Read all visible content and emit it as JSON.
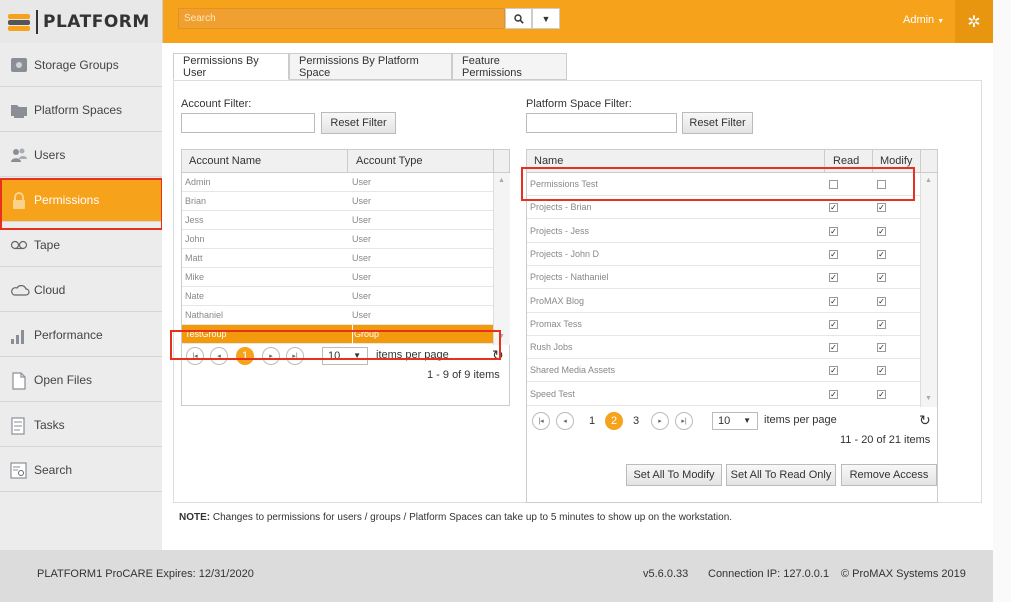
{
  "app": {
    "logo_text": "PLATFORM"
  },
  "topbar": {
    "search_placeholder": "Search",
    "search_button_icon": "search-icon",
    "dropdown_icon": "caret-down-icon",
    "user_menu": "Admin",
    "settings_icon": "gear-icon",
    "accent_color": "#f7a21b"
  },
  "sidebar": {
    "items": [
      {
        "label": "Storage Groups",
        "icon": "storage-icon"
      },
      {
        "label": "Platform Spaces",
        "icon": "folder-icon"
      },
      {
        "label": "Users",
        "icon": "users-icon"
      },
      {
        "label": "Permissions",
        "icon": "lock-icon",
        "active": true
      },
      {
        "label": "Tape",
        "icon": "tape-icon"
      },
      {
        "label": "Cloud",
        "icon": "cloud-icon"
      },
      {
        "label": "Performance",
        "icon": "bar-chart-icon"
      },
      {
        "label": "Open Files",
        "icon": "file-icon"
      },
      {
        "label": "Tasks",
        "icon": "tasks-icon"
      },
      {
        "label": "Search",
        "icon": "search-list-icon"
      }
    ]
  },
  "tabs": [
    {
      "label": "Permissions By User",
      "active": true
    },
    {
      "label": "Permissions By Platform Space"
    },
    {
      "label": "Feature Permissions"
    }
  ],
  "accounts": {
    "filter_label": "Account Filter:",
    "filter_value": "",
    "reset_label": "Reset Filter",
    "columns": [
      "Account Name",
      "Account Type"
    ],
    "rows": [
      {
        "name": "Admin",
        "type": "User"
      },
      {
        "name": "Brian",
        "type": "User"
      },
      {
        "name": "Jess",
        "type": "User"
      },
      {
        "name": "John",
        "type": "User"
      },
      {
        "name": "Matt",
        "type": "User"
      },
      {
        "name": "Mike",
        "type": "User"
      },
      {
        "name": "Nate",
        "type": "User"
      },
      {
        "name": "Nathaniel",
        "type": "User"
      },
      {
        "name": "TestGroup",
        "type": "Group",
        "selected": true
      }
    ],
    "pager": {
      "page": "1",
      "per_page": "10",
      "per_page_label": "items per page",
      "count": "1 - 9 of 9 items"
    }
  },
  "spaces": {
    "filter_label": "Platform Space Filter:",
    "filter_value": "",
    "reset_label": "Reset Filter",
    "columns": [
      "Name",
      "Read",
      "Modify"
    ],
    "rows": [
      {
        "name": "Permissions Test",
        "read": false,
        "modify": false
      },
      {
        "name": "Projects - Brian",
        "read": true,
        "modify": true
      },
      {
        "name": "Projects - Jess",
        "read": true,
        "modify": true
      },
      {
        "name": "Projects - John D",
        "read": true,
        "modify": true
      },
      {
        "name": "Projects - Nathaniel",
        "read": true,
        "modify": true
      },
      {
        "name": "ProMAX Blog",
        "read": true,
        "modify": true
      },
      {
        "name": "Promax Tess",
        "read": true,
        "modify": true
      },
      {
        "name": "Rush Jobs",
        "read": true,
        "modify": true
      },
      {
        "name": "Shared Media Assets",
        "read": true,
        "modify": true
      },
      {
        "name": "Speed Test",
        "read": true,
        "modify": true
      }
    ],
    "pager": {
      "pages": [
        "1",
        "2",
        "3"
      ],
      "current": "2",
      "per_page": "10",
      "per_page_label": "items per page",
      "count": "11 - 20 of 21 items"
    },
    "actions": [
      "Set All To Modify",
      "Set All To Read Only",
      "Remove Access"
    ]
  },
  "note": {
    "bold": "NOTE:",
    "text": " Changes to permissions for users / groups / Platform Spaces can take up to 5 minutes to show up on the workstation."
  },
  "footer": {
    "license": "PLATFORM1 ProCARE Expires: 12/31/2020",
    "version": "v5.6.0.33",
    "connection": "Connection IP: 127.0.0.1",
    "copyright": "© ProMAX Systems 2019"
  }
}
